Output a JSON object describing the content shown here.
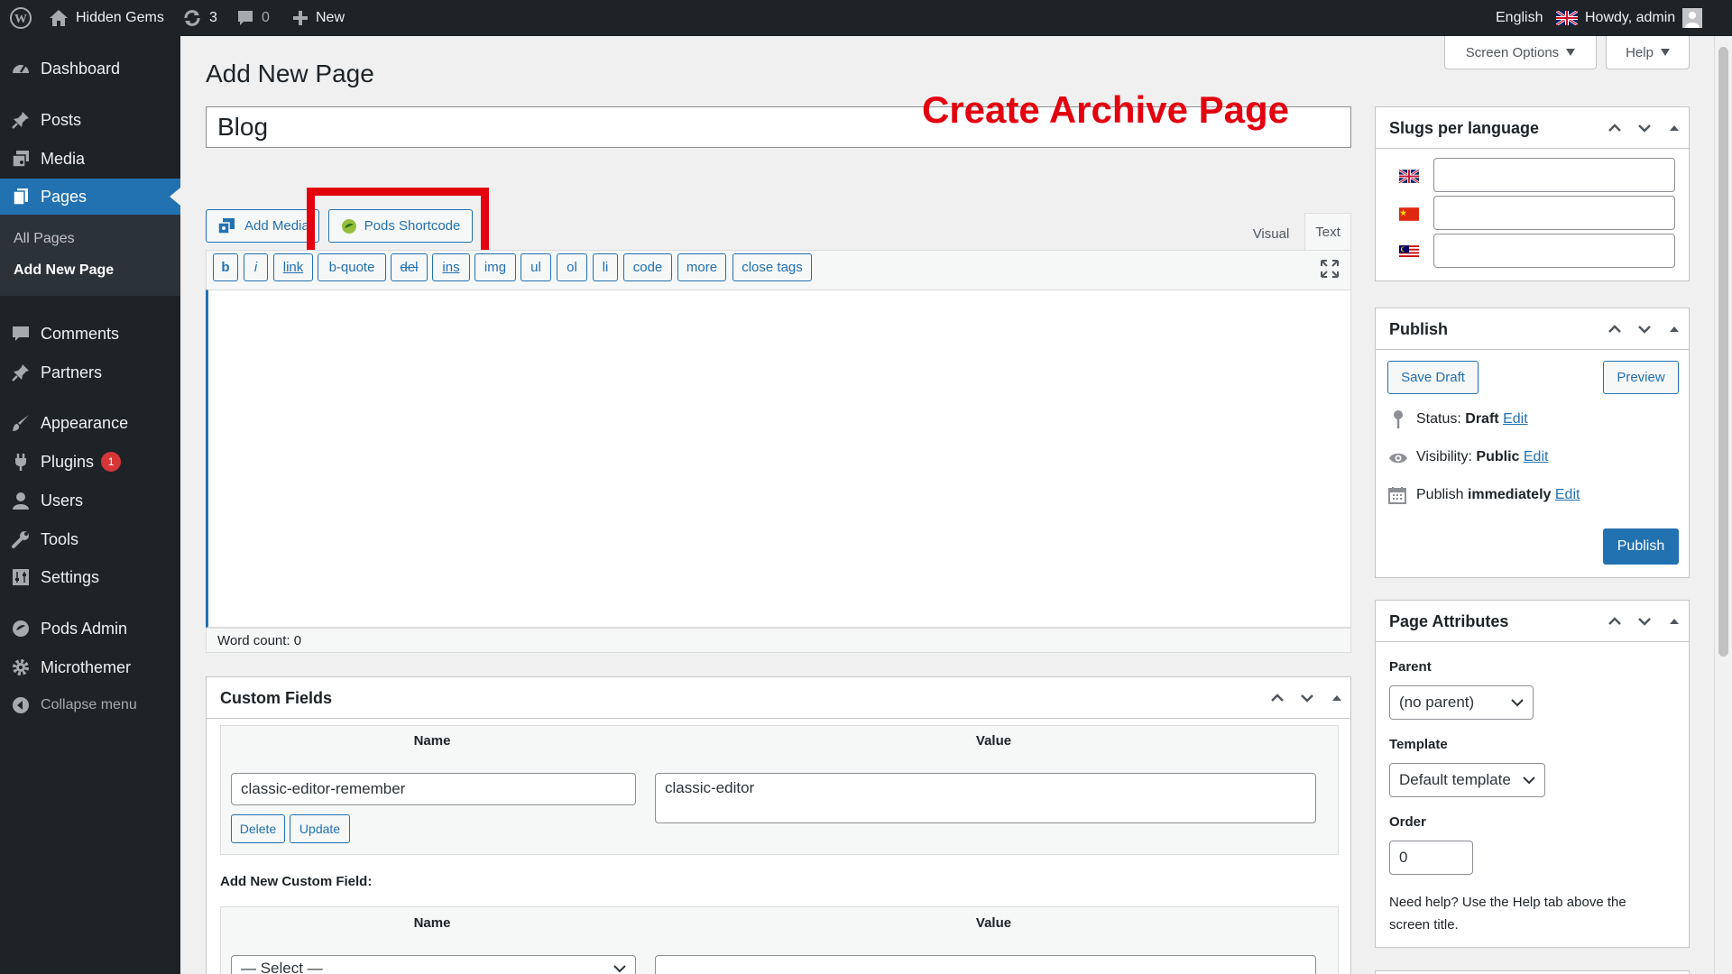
{
  "admin_bar": {
    "site_name": "Hidden Gems",
    "updates_count": "3",
    "comments_count": "0",
    "new_label": "New",
    "language": "English",
    "greeting": "Howdy, admin"
  },
  "sidebar": {
    "items": [
      {
        "label": "Dashboard"
      },
      {
        "label": "Posts"
      },
      {
        "label": "Media"
      },
      {
        "label": "Pages"
      },
      {
        "label": "Comments"
      },
      {
        "label": "Partners"
      },
      {
        "label": "Appearance"
      },
      {
        "label": "Plugins",
        "badge": "1"
      },
      {
        "label": "Users"
      },
      {
        "label": "Tools"
      },
      {
        "label": "Settings"
      },
      {
        "label": "Pods Admin"
      },
      {
        "label": "Microthemer"
      },
      {
        "label": "Collapse menu"
      }
    ],
    "submenu": [
      "All Pages",
      "Add New Page"
    ]
  },
  "header": {
    "screen_options": "Screen Options",
    "help": "Help",
    "page_title": "Add New Page"
  },
  "editor": {
    "title_value": "Blog",
    "annotation": "Create Archive Page",
    "add_media": "Add Media",
    "pods_shortcode": "Pods Shortcode",
    "tab_visual": "Visual",
    "tab_text": "Text",
    "quicktags": [
      "b",
      "i",
      "link",
      "b-quote",
      "del",
      "ins",
      "img",
      "ul",
      "ol",
      "li",
      "code",
      "more",
      "close tags"
    ],
    "word_count": "Word count: 0"
  },
  "custom_fields": {
    "title": "Custom Fields",
    "col_name": "Name",
    "col_value": "Value",
    "row_name": "classic-editor-remember",
    "row_value": "classic-editor",
    "delete": "Delete",
    "update": "Update",
    "add_new_label": "Add New Custom Field:",
    "select_placeholder": "— Select —"
  },
  "slugs": {
    "title": "Slugs per language",
    "languages": [
      "English",
      "Chinese",
      "Malay"
    ]
  },
  "publish": {
    "title": "Publish",
    "save_draft": "Save Draft",
    "preview": "Preview",
    "status_label": "Status:",
    "status_value": "Draft",
    "visibility_label": "Visibility:",
    "visibility_value": "Public",
    "publish_label": "Publish",
    "publish_value": "immediately",
    "edit": "Edit",
    "publish_button": "Publish"
  },
  "page_attributes": {
    "title": "Page Attributes",
    "parent_label": "Parent",
    "parent_value": "(no parent)",
    "template_label": "Template",
    "template_value": "Default template",
    "order_label": "Order",
    "order_value": "0",
    "help_text": "Need help? Use the Help tab above the screen title."
  },
  "colors": {
    "admin_dark": "#1d2327",
    "accent": "#2271b1",
    "annotation_red": "#e3000f",
    "badge_red": "#d63638"
  }
}
